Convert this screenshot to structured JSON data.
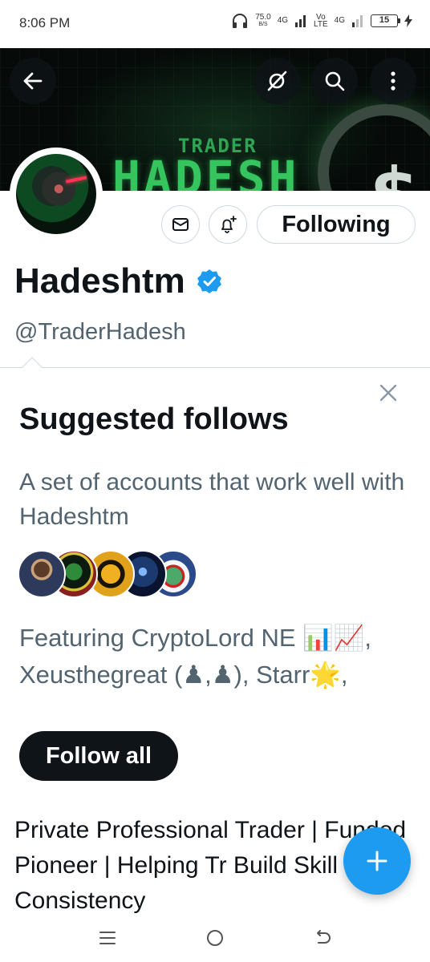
{
  "status_bar": {
    "time": "8:06 PM",
    "speed_value": "75.0",
    "speed_unit": "B/S",
    "net1": "4G",
    "net2_top": "Vo",
    "net2_bottom": "LTE",
    "net3": "4G",
    "battery": "15"
  },
  "header": {
    "banner_subtitle": "TRADER",
    "banner_title": "HADESH"
  },
  "profile": {
    "following_label": "Following",
    "display_name": "Hadeshtm",
    "handle": "@TraderHadesh",
    "bio": "Private Professional Trader | Funded Pioneer | Helping Tr Build Skill & Consistency"
  },
  "suggested": {
    "title": "Suggested follows",
    "description": "A set of accounts that work well with Hadeshtm",
    "featuring": "Featuring CryptoLord NE 📊📈, Xeusthegreat (♟,♟), Starr🌟,",
    "follow_all_label": "Follow all"
  },
  "colors": {
    "accent": "#1d9bf0",
    "text_primary": "#0f1419",
    "text_secondary": "#536471",
    "banner_green": "#36c45e"
  },
  "icons": [
    "back-arrow-icon",
    "grok-icon",
    "search-icon",
    "more-icon",
    "mail-icon",
    "bell-plus-icon",
    "verified-icon",
    "close-icon",
    "compose-plus-icon"
  ]
}
